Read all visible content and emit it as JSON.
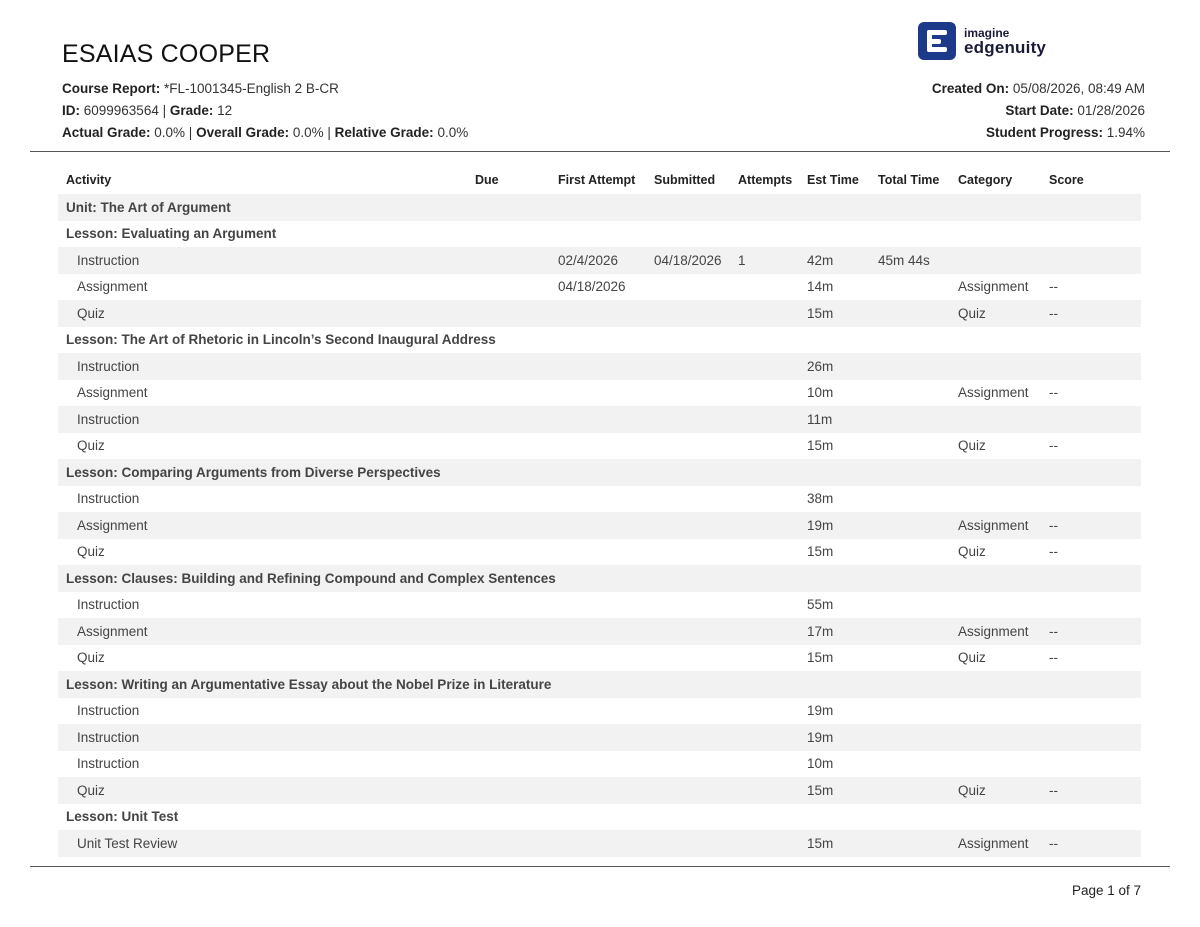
{
  "student": {
    "name": "ESAIAS COOPER"
  },
  "header": {
    "course_label": "Course Report:",
    "course_value": " *FL-1001345-English 2 B-CR",
    "id_label": "ID:",
    "id_value": " 6099963564 | ",
    "grade_label": "Grade:",
    "grade_value": " 12",
    "actual_label": "Actual Grade:",
    "actual_value": " 0.0% | ",
    "overall_label": "Overall Grade:",
    "overall_value": " 0.0% | ",
    "relative_label": "Relative Grade:",
    "relative_value": " 0.0%",
    "created_label": "Created On:",
    "created_value": " 05/08/2026, 08:49 AM",
    "start_label": "Start Date:",
    "start_value": " 01/28/2026",
    "progress_label": "Student Progress:",
    "progress_value": " 1.94%"
  },
  "logo": {
    "line1": "imagine",
    "line2": "edgenuity",
    "brand_color": "#1d3a8a"
  },
  "table": {
    "columns": [
      "Activity",
      "Due",
      "First Attempt",
      "Submitted",
      "Attempts",
      "Est Time",
      "Total Time",
      "Category",
      "Score"
    ],
    "rows": [
      {
        "kind": "unit",
        "title": "Unit: The Art of Argument"
      },
      {
        "kind": "lesson",
        "title": "Lesson: Evaluating an Argument"
      },
      {
        "kind": "item",
        "activity": "Instruction",
        "due": "",
        "first": "02/4/2026",
        "submitted": "04/18/2026",
        "attempts": "1",
        "est": "42m",
        "total": "45m 44s",
        "category": "",
        "score": ""
      },
      {
        "kind": "item",
        "activity": "Assignment",
        "due": "",
        "first": "04/18/2026",
        "submitted": "",
        "attempts": "",
        "est": "14m",
        "total": "",
        "category": "Assignment",
        "score": "--"
      },
      {
        "kind": "item",
        "activity": "Quiz",
        "due": "",
        "first": "",
        "submitted": "",
        "attempts": "",
        "est": "15m",
        "total": "",
        "category": "Quiz",
        "score": "--"
      },
      {
        "kind": "lesson",
        "title": "Lesson: The Art of Rhetoric in Lincoln’s Second Inaugural Address"
      },
      {
        "kind": "item",
        "activity": "Instruction",
        "due": "",
        "first": "",
        "submitted": "",
        "attempts": "",
        "est": "26m",
        "total": "",
        "category": "",
        "score": ""
      },
      {
        "kind": "item",
        "activity": "Assignment",
        "due": "",
        "first": "",
        "submitted": "",
        "attempts": "",
        "est": "10m",
        "total": "",
        "category": "Assignment",
        "score": "--"
      },
      {
        "kind": "item",
        "activity": "Instruction",
        "due": "",
        "first": "",
        "submitted": "",
        "attempts": "",
        "est": "11m",
        "total": "",
        "category": "",
        "score": ""
      },
      {
        "kind": "item",
        "activity": "Quiz",
        "due": "",
        "first": "",
        "submitted": "",
        "attempts": "",
        "est": "15m",
        "total": "",
        "category": "Quiz",
        "score": "--"
      },
      {
        "kind": "lesson",
        "title": "Lesson: Comparing Arguments from Diverse Perspectives"
      },
      {
        "kind": "item",
        "activity": "Instruction",
        "due": "",
        "first": "",
        "submitted": "",
        "attempts": "",
        "est": "38m",
        "total": "",
        "category": "",
        "score": ""
      },
      {
        "kind": "item",
        "activity": "Assignment",
        "due": "",
        "first": "",
        "submitted": "",
        "attempts": "",
        "est": "19m",
        "total": "",
        "category": "Assignment",
        "score": "--"
      },
      {
        "kind": "item",
        "activity": "Quiz",
        "due": "",
        "first": "",
        "submitted": "",
        "attempts": "",
        "est": "15m",
        "total": "",
        "category": "Quiz",
        "score": "--"
      },
      {
        "kind": "lesson",
        "title": "Lesson: Clauses: Building and Refining Compound and Complex Sentences"
      },
      {
        "kind": "item",
        "activity": "Instruction",
        "due": "",
        "first": "",
        "submitted": "",
        "attempts": "",
        "est": "55m",
        "total": "",
        "category": "",
        "score": ""
      },
      {
        "kind": "item",
        "activity": "Assignment",
        "due": "",
        "first": "",
        "submitted": "",
        "attempts": "",
        "est": "17m",
        "total": "",
        "category": "Assignment",
        "score": "--"
      },
      {
        "kind": "item",
        "activity": "Quiz",
        "due": "",
        "first": "",
        "submitted": "",
        "attempts": "",
        "est": "15m",
        "total": "",
        "category": "Quiz",
        "score": "--"
      },
      {
        "kind": "lesson",
        "title": "Lesson: Writing an Argumentative Essay about the Nobel Prize in Literature"
      },
      {
        "kind": "item",
        "activity": "Instruction",
        "due": "",
        "first": "",
        "submitted": "",
        "attempts": "",
        "est": "19m",
        "total": "",
        "category": "",
        "score": ""
      },
      {
        "kind": "item",
        "activity": "Instruction",
        "due": "",
        "first": "",
        "submitted": "",
        "attempts": "",
        "est": "19m",
        "total": "",
        "category": "",
        "score": ""
      },
      {
        "kind": "item",
        "activity": "Instruction",
        "due": "",
        "first": "",
        "submitted": "",
        "attempts": "",
        "est": "10m",
        "total": "",
        "category": "",
        "score": ""
      },
      {
        "kind": "item",
        "activity": "Quiz",
        "due": "",
        "first": "",
        "submitted": "",
        "attempts": "",
        "est": "15m",
        "total": "",
        "category": "Quiz",
        "score": "--"
      },
      {
        "kind": "lesson",
        "title": "Lesson: Unit Test"
      },
      {
        "kind": "item",
        "activity": "Unit Test Review",
        "due": "",
        "first": "",
        "submitted": "",
        "attempts": "",
        "est": "15m",
        "total": "",
        "category": "Assignment",
        "score": "--"
      }
    ]
  },
  "footer": {
    "page_label": "Page 1 of 7"
  }
}
